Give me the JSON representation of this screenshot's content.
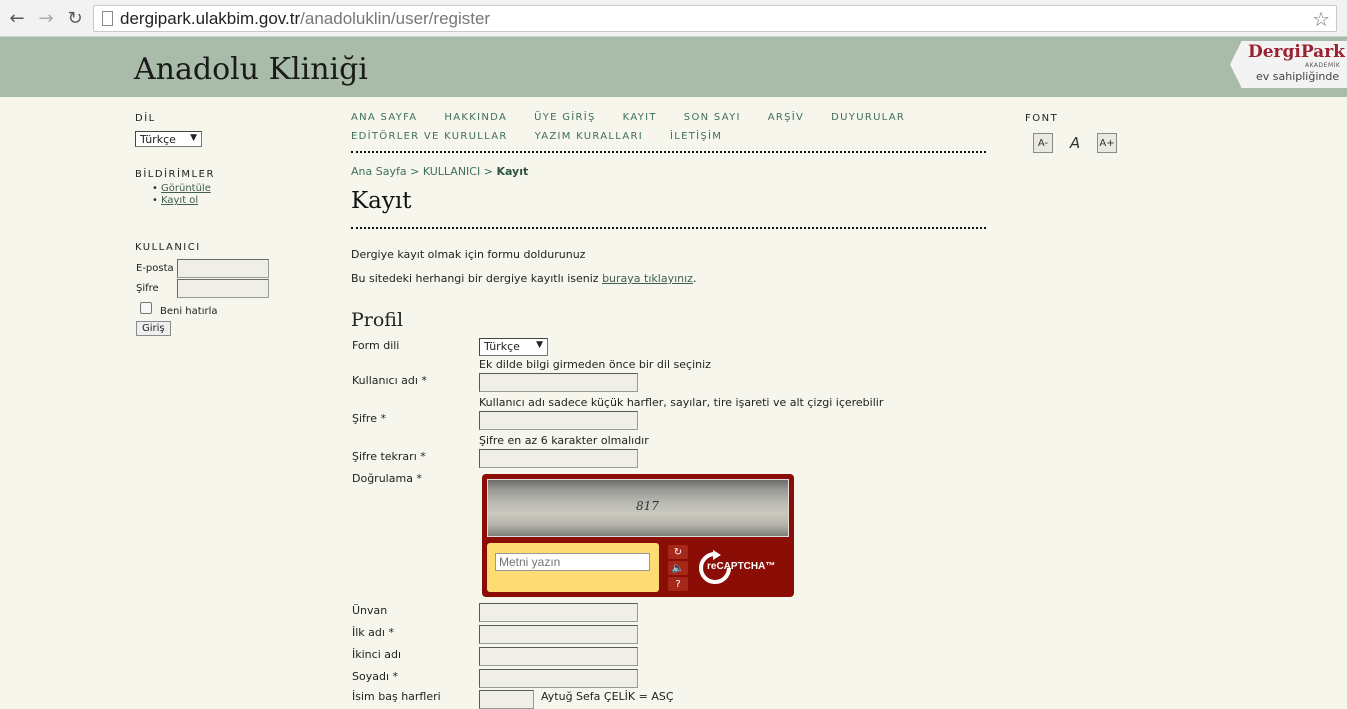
{
  "browser": {
    "url_host": "dergipark.ulakbim.gov.tr",
    "url_path": "/anadoluklin/user/register"
  },
  "header": {
    "journal_title": "Anadolu Kliniği",
    "logo_name": "DergiPark",
    "logo_sub": "AKADEMİK",
    "logo_tagline": "ev sahipliğinde"
  },
  "sidebar": {
    "language_heading": "DİL",
    "language_value": "Türkçe",
    "notifications_heading": "BİLDİRİMLER",
    "notifications_links": [
      "Görüntüle",
      "Kayıt ol"
    ],
    "user_heading": "KULLANICI",
    "email_label": "E-posta",
    "password_label": "Şifre",
    "remember_label": "Beni hatırla",
    "login_button": "Giriş"
  },
  "nav": {
    "row1": [
      "ANA SAYFA",
      "HAKKINDA",
      "ÜYE GİRİŞ",
      "KAYIT",
      "SON SAYI",
      "ARŞİV",
      "DUYURULAR"
    ],
    "row2": [
      "EDİTÖRLER VE KURULLAR",
      "YAZIM KURALLARI",
      "İLETİŞİM"
    ]
  },
  "breadcrumb": {
    "home": "Ana Sayfa",
    "sep": ">",
    "section": "KULLANICI",
    "current": "Kayıt"
  },
  "page": {
    "title": "Kayıt",
    "intro": "Dergiye kayıt olmak için formu doldurunuz",
    "registered_prefix": "Bu sitedeki herhangi bir dergiye kayıtlı iseniz",
    "registered_link": "buraya tıklayınız",
    "registered_suffix": ".",
    "profile_heading": "Profil"
  },
  "form": {
    "form_language_label": "Form dili",
    "form_language_value": "Türkçe",
    "form_language_hint": "Ek dilde bilgi girmeden önce bir dil seçiniz",
    "username_label": "Kullanıcı adı *",
    "username_hint": "Kullanıcı adı sadece küçük harfler, sayılar, tire işareti ve alt çizgi içerebilir",
    "password_label": "Şifre *",
    "password_hint": "Şifre en az 6 karakter olmalıdır",
    "password_repeat_label": "Şifre tekrarı *",
    "verification_label": "Doğrulama *",
    "title_label": "Ünvan",
    "first_name_label": "İlk adı *",
    "middle_name_label": "İkinci adı",
    "last_name_label": "Soyadı *",
    "initials_label": "İsim baş harfleri",
    "initials_hint": "Aytuğ Sefa ÇELİK = ASÇ"
  },
  "captcha": {
    "challenge_text": "817",
    "input_placeholder": "Metni yazın",
    "brand": "reCAPTCHA™"
  },
  "font_tool": {
    "heading": "FONT",
    "buttons": [
      "A-",
      "A",
      "A+"
    ]
  }
}
